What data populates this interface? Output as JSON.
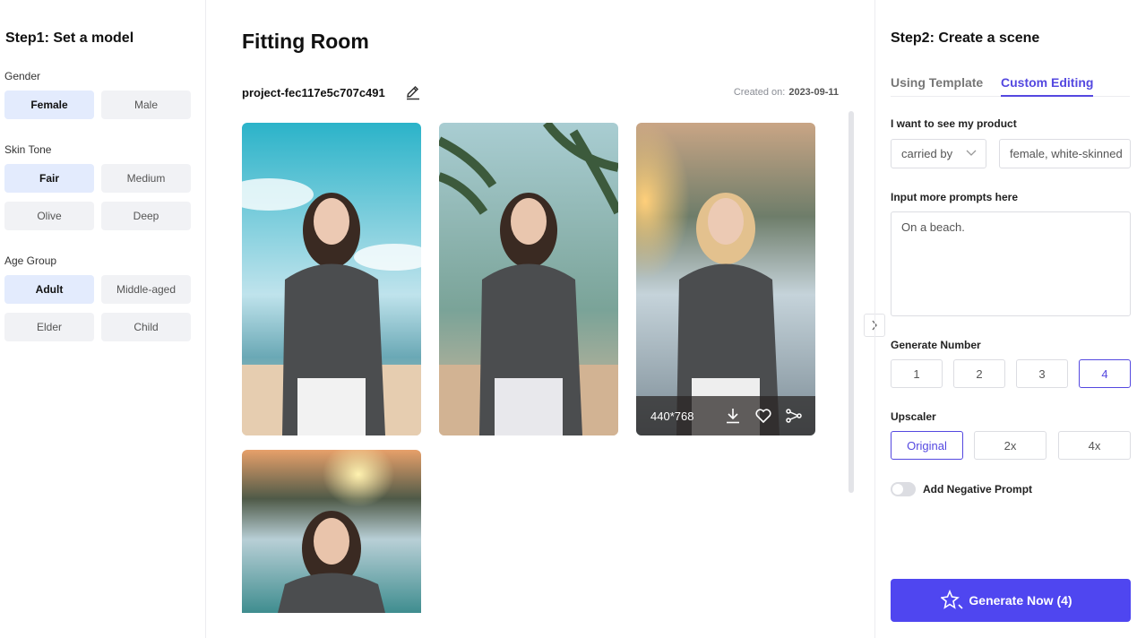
{
  "left_panel": {
    "title": "Step1: Set a model",
    "gender": {
      "label": "Gender",
      "options": [
        "Female",
        "Male"
      ],
      "selected": "Female"
    },
    "skin_tone": {
      "label": "Skin Tone",
      "options": [
        "Fair",
        "Medium",
        "Olive",
        "Deep"
      ],
      "selected": "Fair"
    },
    "age_group": {
      "label": "Age Group",
      "options": [
        "Adult",
        "Middle-aged",
        "Elder",
        "Child"
      ],
      "selected": "Adult"
    }
  },
  "center": {
    "title": "Fitting Room",
    "project_name": "project-fec117e5c707c491",
    "created_label": "Created on:",
    "created_date": "2023-09-11",
    "images": [
      {
        "scene": "beach-sky-brunette"
      },
      {
        "scene": "beach-palm-brunette"
      },
      {
        "scene": "beach-sunset-blonde",
        "hovered": true,
        "dimensions": "440*768"
      },
      {
        "scene": "beach-sunset-waves-brunette"
      }
    ],
    "icons": {
      "edit": "pencil-icon",
      "download": "download-icon",
      "favorite": "heart-icon",
      "share": "share-icon",
      "collapse": "chevron-right-icon"
    }
  },
  "right_panel": {
    "title": "Step2: Create a scene",
    "tabs": [
      {
        "label": "Using Template",
        "active": false
      },
      {
        "label": "Custom Editing",
        "active": true
      }
    ],
    "product_label": "I want to see my product",
    "product_select": "carried by",
    "product_input": "female, white-skinned",
    "prompt_label": "Input more prompts here",
    "prompt_value": "On a beach.",
    "generate_number_label": "Generate Number",
    "numbers": [
      "1",
      "2",
      "3",
      "4"
    ],
    "selected_number": "4",
    "upscaler_label": "Upscaler",
    "upscaler_options": [
      "Original",
      "2x",
      "4x"
    ],
    "selected_upscaler": "Original",
    "negative_prompt_label": "Add Negative Prompt",
    "negative_prompt_enabled": false,
    "generate_button": "Generate Now (4)",
    "accent_color": "#4f46f0"
  }
}
